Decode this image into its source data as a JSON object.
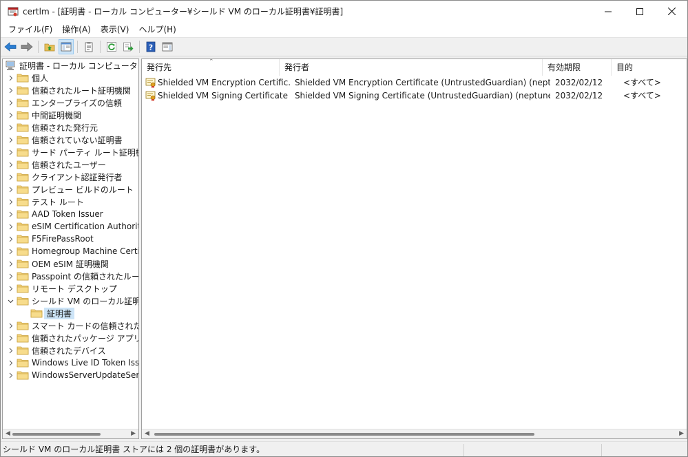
{
  "window": {
    "title": "certlm - [証明書 - ローカル コンピューター¥シールド VM のローカル証明書¥証明書]",
    "minimize_icon": "minimize-icon",
    "maximize_icon": "maximize-icon",
    "close_icon": "close-icon"
  },
  "menu": [
    {
      "label": "ファイル(F)"
    },
    {
      "label": "操作(A)"
    },
    {
      "label": "表示(V)"
    },
    {
      "label": "ヘルプ(H)"
    }
  ],
  "toolbar": [
    {
      "icon": "back-arrow-icon"
    },
    {
      "icon": "forward-arrow-icon"
    },
    {
      "icon": "up-folder-icon"
    },
    {
      "icon": "show-hide-tree-icon"
    },
    {
      "icon": "properties-icon"
    },
    {
      "icon": "refresh-icon"
    },
    {
      "icon": "export-list-icon"
    },
    {
      "icon": "help-icon"
    },
    {
      "icon": "action-pane-icon"
    }
  ],
  "tree": {
    "root": "証明書 - ローカル コンピューター",
    "items": [
      {
        "label": "個人"
      },
      {
        "label": "信頼されたルート証明機関"
      },
      {
        "label": "エンタープライズの信頼"
      },
      {
        "label": "中間証明機関"
      },
      {
        "label": "信頼された発行元"
      },
      {
        "label": "信頼されていない証明書"
      },
      {
        "label": "サード パーティ ルート証明機関"
      },
      {
        "label": "信頼されたユーザー"
      },
      {
        "label": "クライアント認証発行者"
      },
      {
        "label": "プレビュー ビルドのルート"
      },
      {
        "label": "テスト ルート"
      },
      {
        "label": "AAD Token Issuer"
      },
      {
        "label": "eSIM Certification Authorities"
      },
      {
        "label": "F5FirePassRoot"
      },
      {
        "label": "Homegroup Machine Certificates"
      },
      {
        "label": "OEM eSIM 証明機関"
      },
      {
        "label": "Passpoint の信頼されたルート"
      },
      {
        "label": "リモート デスクトップ"
      },
      {
        "label": "シールド VM のローカル証明書"
      },
      {
        "label": "証明書"
      },
      {
        "label": "スマート カードの信頼されたルート"
      },
      {
        "label": "信頼されたパッケージ アプリのインストール機関"
      },
      {
        "label": "信頼されたデバイス"
      },
      {
        "label": "Windows Live ID Token Issuer"
      },
      {
        "label": "WindowsServerUpdateServices"
      }
    ]
  },
  "list": {
    "columns": [
      "発行先",
      "発行者",
      "有効期限",
      "目的"
    ],
    "rows": [
      {
        "issued_to": "Shielded VM Encryption Certific...",
        "issued_by": "Shielded VM Encryption Certificate (UntrustedGuardian) (neptune)",
        "expires": "2032/02/12",
        "purpose": "<すべて>"
      },
      {
        "issued_to": "Shielded VM Signing Certificate ...",
        "issued_by": "Shielded VM Signing Certificate (UntrustedGuardian) (neptune)",
        "expires": "2032/02/12",
        "purpose": "<すべて>"
      }
    ]
  },
  "status": {
    "text": "シールド VM のローカル証明書 ストアには 2 個の証明書があります。"
  }
}
